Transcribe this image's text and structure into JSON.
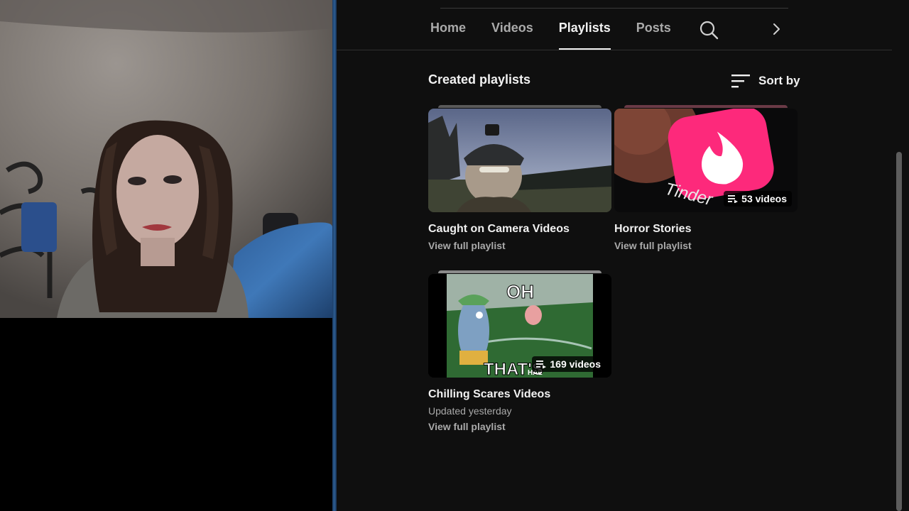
{
  "channel_page": {
    "tabs": [
      {
        "label": "Home",
        "active": false
      },
      {
        "label": "Videos",
        "active": false
      },
      {
        "label": "Playlists",
        "active": true
      },
      {
        "label": "Posts",
        "active": false
      }
    ],
    "section_title": "Created playlists",
    "sort_label": "Sort by",
    "playlists": [
      {
        "title": "Caught on Camera Videos",
        "meta": "",
        "link": "View full playlist",
        "badge": ""
      },
      {
        "title": "Horror Stories",
        "meta": "",
        "link": "View full playlist",
        "badge": "53 videos",
        "thumb_text": "Tinder"
      },
      {
        "title": "Chilling Scares Videos",
        "meta": "Updated yesterday",
        "link": "View full playlist",
        "badge": "169 videos",
        "thumb_top_text": "OH",
        "thumb_bottom_text": "THAT'S",
        "thumb_bottom_small": "HAL"
      }
    ]
  },
  "icons": {
    "search": "search-icon",
    "next": "chevron-right-icon",
    "sort": "sort-icon",
    "playlist": "playlist-icon"
  },
  "colors": {
    "background": "#0f0f0f",
    "text_primary": "#f1f1f1",
    "text_secondary": "#aaaaaa",
    "tinder_pink": "#fd297b",
    "divider_blue": "#2d5d92"
  }
}
